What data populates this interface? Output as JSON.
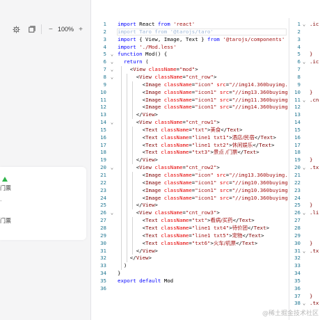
{
  "toolbar": {
    "settings_icon": "gear-icon",
    "layout_icon": "layout-icon",
    "zoom_out": "−",
    "zoom_level": "100%",
    "zoom_in": "+"
  },
  "preview_card": {
    "items": [
      "门票",
      "-",
      "门票"
    ]
  },
  "editor": {
    "lines": [
      {
        "n": "1",
        "fold": "",
        "segs": [
          [
            "kw",
            "import "
          ],
          [
            "",
            "React "
          ],
          [
            "kw",
            "from "
          ],
          [
            "str",
            "'react'"
          ]
        ]
      },
      {
        "n": "2",
        "fold": "",
        "segs": [
          [
            "faded",
            "import Taro from '@tarojs/taro'"
          ]
        ]
      },
      {
        "n": "3",
        "fold": "",
        "segs": [
          [
            "kw",
            "import "
          ],
          [
            "",
            "{ View, Image, Text } "
          ],
          [
            "kw",
            "from "
          ],
          [
            "str",
            "'@tarojs/components'"
          ]
        ]
      },
      {
        "n": "4",
        "fold": "",
        "segs": [
          [
            "kw",
            "import "
          ],
          [
            "str",
            "'./Mod.less'"
          ]
        ]
      },
      {
        "n": "5",
        "fold": "⌄",
        "segs": [
          [
            "kw",
            "function "
          ],
          [
            "",
            "Mod() {"
          ]
        ]
      },
      {
        "n": "6",
        "fold": "⌄",
        "segs": [
          [
            "",
            "  "
          ],
          [
            "kw",
            "return "
          ],
          [
            "",
            "("
          ]
        ]
      },
      {
        "n": "7",
        "fold": "⌄",
        "segs": [
          [
            "",
            "    <"
          ],
          [
            "tag",
            "View "
          ],
          [
            "attr",
            "className"
          ],
          [
            "",
            "="
          ],
          [
            "str",
            "\"mod\""
          ],
          [
            "",
            ">"
          ]
        ]
      },
      {
        "n": "8",
        "fold": "⌄",
        "segs": [
          [
            "",
            "      <"
          ],
          [
            "tag",
            "View "
          ],
          [
            "attr",
            "className"
          ],
          [
            "",
            "="
          ],
          [
            "str",
            "\"cnt_row\""
          ],
          [
            "",
            ">"
          ]
        ]
      },
      {
        "n": "9",
        "fold": "",
        "segs": [
          [
            "",
            "        <"
          ],
          [
            "tag",
            "Image "
          ],
          [
            "attr",
            "className"
          ],
          [
            "",
            "="
          ],
          [
            "str",
            "\"icon\" "
          ],
          [
            "attr",
            "src"
          ],
          [
            "",
            "="
          ],
          [
            "str",
            "\"//img14.360buyimg.co"
          ]
        ]
      },
      {
        "n": "10",
        "fold": "",
        "segs": [
          [
            "",
            "        <"
          ],
          [
            "tag",
            "Image "
          ],
          [
            "attr",
            "className"
          ],
          [
            "",
            "="
          ],
          [
            "str",
            "\"icon1\" "
          ],
          [
            "attr",
            "src"
          ],
          [
            "",
            "="
          ],
          [
            "str",
            "\"//img13.360buyimg.c"
          ]
        ]
      },
      {
        "n": "11",
        "fold": "",
        "segs": [
          [
            "",
            "        <"
          ],
          [
            "tag",
            "Image "
          ],
          [
            "attr",
            "className"
          ],
          [
            "",
            "="
          ],
          [
            "str",
            "\"icon1\" "
          ],
          [
            "attr",
            "src"
          ],
          [
            "",
            "="
          ],
          [
            "str",
            "\"//img11.360buyimg.c"
          ]
        ]
      },
      {
        "n": "12",
        "fold": "",
        "segs": [
          [
            "",
            "        <"
          ],
          [
            "tag",
            "Image "
          ],
          [
            "attr",
            "className"
          ],
          [
            "",
            "="
          ],
          [
            "str",
            "\"icon1\" "
          ],
          [
            "attr",
            "src"
          ],
          [
            "",
            "="
          ],
          [
            "str",
            "\"//img14.360buyimg.c"
          ]
        ]
      },
      {
        "n": "13",
        "fold": "",
        "segs": [
          [
            "",
            "      </"
          ],
          [
            "tag",
            "View"
          ],
          [
            "",
            ">"
          ]
        ]
      },
      {
        "n": "14",
        "fold": "⌄",
        "segs": [
          [
            "",
            "      <"
          ],
          [
            "tag",
            "View "
          ],
          [
            "attr",
            "className"
          ],
          [
            "",
            "="
          ],
          [
            "str",
            "\"cnt_row1\""
          ],
          [
            "",
            ">"
          ]
        ]
      },
      {
        "n": "15",
        "fold": "",
        "segs": [
          [
            "",
            "        <"
          ],
          [
            "tag",
            "Text "
          ],
          [
            "attr",
            "className"
          ],
          [
            "",
            "="
          ],
          [
            "str",
            "\"txt\""
          ],
          [
            "",
            ">"
          ],
          [
            "cjk",
            "美食"
          ],
          [
            "",
            "</"
          ],
          [
            "tag",
            "Text"
          ],
          [
            "",
            ">"
          ]
        ]
      },
      {
        "n": "16",
        "fold": "",
        "segs": [
          [
            "",
            "        <"
          ],
          [
            "tag",
            "Text "
          ],
          [
            "attr",
            "className"
          ],
          [
            "",
            "="
          ],
          [
            "str",
            "\"line1 txt1\""
          ],
          [
            "",
            ">"
          ],
          [
            "cjk",
            "酒店/民宿"
          ],
          [
            "",
            "</"
          ],
          [
            "tag",
            "Text"
          ],
          [
            "",
            ">"
          ]
        ]
      },
      {
        "n": "17",
        "fold": "",
        "segs": [
          [
            "",
            "        <"
          ],
          [
            "tag",
            "Text "
          ],
          [
            "attr",
            "className"
          ],
          [
            "",
            "="
          ],
          [
            "str",
            "\"line1 txt2\""
          ],
          [
            "",
            ">"
          ],
          [
            "cjk",
            "休闲娱乐"
          ],
          [
            "",
            "</"
          ],
          [
            "tag",
            "Text"
          ],
          [
            "",
            ">"
          ]
        ]
      },
      {
        "n": "18",
        "fold": "",
        "segs": [
          [
            "",
            "        <"
          ],
          [
            "tag",
            "Text "
          ],
          [
            "attr",
            "className"
          ],
          [
            "",
            "="
          ],
          [
            "str",
            "\"txt3\""
          ],
          [
            "",
            ">"
          ],
          [
            "cjk",
            "景点 /门票"
          ],
          [
            "",
            "</"
          ],
          [
            "tag",
            "Text"
          ],
          [
            "",
            ">"
          ]
        ]
      },
      {
        "n": "19",
        "fold": "",
        "segs": [
          [
            "",
            "      </"
          ],
          [
            "tag",
            "View"
          ],
          [
            "",
            ">"
          ]
        ]
      },
      {
        "n": "20",
        "fold": "⌄",
        "segs": [
          [
            "",
            "      <"
          ],
          [
            "tag",
            "View "
          ],
          [
            "attr",
            "className"
          ],
          [
            "",
            "="
          ],
          [
            "str",
            "\"cnt_row2\""
          ],
          [
            "",
            ">"
          ]
        ]
      },
      {
        "n": "21",
        "fold": "",
        "segs": [
          [
            "",
            "        <"
          ],
          [
            "tag",
            "Image "
          ],
          [
            "attr",
            "className"
          ],
          [
            "",
            "="
          ],
          [
            "str",
            "\"icon\" "
          ],
          [
            "attr",
            "src"
          ],
          [
            "",
            "="
          ],
          [
            "str",
            "\"//img13.360buyimg.co"
          ]
        ]
      },
      {
        "n": "22",
        "fold": "",
        "segs": [
          [
            "",
            "        <"
          ],
          [
            "tag",
            "Image "
          ],
          [
            "attr",
            "className"
          ],
          [
            "",
            "="
          ],
          [
            "str",
            "\"icon1\" "
          ],
          [
            "attr",
            "src"
          ],
          [
            "",
            "="
          ],
          [
            "str",
            "\"//img10.360buyimg.c"
          ]
        ]
      },
      {
        "n": "23",
        "fold": "",
        "segs": [
          [
            "",
            "        <"
          ],
          [
            "tag",
            "Image "
          ],
          [
            "attr",
            "className"
          ],
          [
            "",
            "="
          ],
          [
            "str",
            "\"icon1\" "
          ],
          [
            "attr",
            "src"
          ],
          [
            "",
            "="
          ],
          [
            "str",
            "\"//img10.360buyimg.c"
          ]
        ]
      },
      {
        "n": "24",
        "fold": "",
        "segs": [
          [
            "",
            "        <"
          ],
          [
            "tag",
            "Image "
          ],
          [
            "attr",
            "className"
          ],
          [
            "",
            "="
          ],
          [
            "str",
            "\"icon1\" "
          ],
          [
            "attr",
            "src"
          ],
          [
            "",
            "="
          ],
          [
            "str",
            "\"//img10.360buyimg.c"
          ]
        ]
      },
      {
        "n": "25",
        "fold": "",
        "segs": [
          [
            "",
            "      </"
          ],
          [
            "tag",
            "View"
          ],
          [
            "",
            ">"
          ]
        ]
      },
      {
        "n": "26",
        "fold": "⌄",
        "segs": [
          [
            "",
            "      <"
          ],
          [
            "tag",
            "View "
          ],
          [
            "attr",
            "className"
          ],
          [
            "",
            "="
          ],
          [
            "str",
            "\"cnt_row3\""
          ],
          [
            "",
            ">"
          ]
        ]
      },
      {
        "n": "27",
        "fold": "",
        "segs": [
          [
            "",
            "        <"
          ],
          [
            "tag",
            "Text "
          ],
          [
            "attr",
            "className"
          ],
          [
            "",
            "="
          ],
          [
            "str",
            "\"txt\""
          ],
          [
            "",
            ">"
          ],
          [
            "cjk",
            "看病/买药"
          ],
          [
            "",
            "</"
          ],
          [
            "tag",
            "Text"
          ],
          [
            "",
            ">"
          ]
        ]
      },
      {
        "n": "28",
        "fold": "",
        "segs": [
          [
            "",
            "        <"
          ],
          [
            "tag",
            "Text "
          ],
          [
            "attr",
            "className"
          ],
          [
            "",
            "="
          ],
          [
            "str",
            "\"line1 txt4\""
          ],
          [
            "",
            ">"
          ],
          [
            "cjk",
            "待价团"
          ],
          [
            "",
            "</"
          ],
          [
            "tag",
            "Text"
          ],
          [
            "",
            ">"
          ]
        ]
      },
      {
        "n": "29",
        "fold": "",
        "segs": [
          [
            "",
            "        <"
          ],
          [
            "tag",
            "Text "
          ],
          [
            "attr",
            "className"
          ],
          [
            "",
            "="
          ],
          [
            "str",
            "\"line1 txt5\""
          ],
          [
            "",
            ">"
          ],
          [
            "cjk",
            "宠物"
          ],
          [
            "",
            "</"
          ],
          [
            "tag",
            "Text"
          ],
          [
            "",
            ">"
          ]
        ]
      },
      {
        "n": "30",
        "fold": "",
        "segs": [
          [
            "",
            "        <"
          ],
          [
            "tag",
            "Text "
          ],
          [
            "attr",
            "className"
          ],
          [
            "",
            "="
          ],
          [
            "str",
            "\"txt6\""
          ],
          [
            "",
            ">"
          ],
          [
            "cjk",
            "火车/机票"
          ],
          [
            "",
            "</"
          ],
          [
            "tag",
            "Text"
          ],
          [
            "",
            ">"
          ]
        ]
      },
      {
        "n": "31",
        "fold": "",
        "segs": [
          [
            "",
            "      </"
          ],
          [
            "tag",
            "View"
          ],
          [
            "",
            ">"
          ]
        ]
      },
      {
        "n": "32",
        "fold": "",
        "segs": [
          [
            "",
            "    </"
          ],
          [
            "tag",
            "View"
          ],
          [
            "",
            ">"
          ]
        ]
      },
      {
        "n": "33",
        "fold": "",
        "segs": [
          [
            "",
            "  )"
          ]
        ]
      },
      {
        "n": "34",
        "fold": "",
        "segs": [
          [
            "",
            "}"
          ]
        ]
      },
      {
        "n": "35",
        "fold": "",
        "segs": [
          [
            "kw",
            "export default "
          ],
          [
            "",
            "Mod"
          ]
        ]
      },
      {
        "n": "36",
        "fold": "",
        "segs": []
      }
    ]
  },
  "right_pane": {
    "lines": [
      {
        "n": "1",
        "fold": "⌄",
        "code": ".ic"
      },
      {
        "n": "2",
        "fold": "",
        "code": ""
      },
      {
        "n": "3",
        "fold": "",
        "code": ""
      },
      {
        "n": "4",
        "fold": "",
        "code": ""
      },
      {
        "n": "5",
        "fold": "",
        "code": "}"
      },
      {
        "n": "6",
        "fold": "⌄",
        "code": ".ic"
      },
      {
        "n": "7",
        "fold": "",
        "code": ""
      },
      {
        "n": "8",
        "fold": "",
        "code": ""
      },
      {
        "n": "9",
        "fold": "",
        "code": ""
      },
      {
        "n": "10",
        "fold": "",
        "code": "}"
      },
      {
        "n": "11",
        "fold": "⌄",
        "code": ".cn"
      },
      {
        "n": "12",
        "fold": "",
        "code": ""
      },
      {
        "n": "13",
        "fold": "",
        "code": ""
      },
      {
        "n": "14",
        "fold": "",
        "code": ""
      },
      {
        "n": "15",
        "fold": "",
        "code": ""
      },
      {
        "n": "16",
        "fold": "",
        "code": ""
      },
      {
        "n": "17",
        "fold": "",
        "code": ""
      },
      {
        "n": "18",
        "fold": "",
        "code": ""
      },
      {
        "n": "19",
        "fold": "",
        "code": "}"
      },
      {
        "n": "20",
        "fold": "⌄",
        "code": ".tx"
      },
      {
        "n": "21",
        "fold": "",
        "code": ""
      },
      {
        "n": "22",
        "fold": "",
        "code": ""
      },
      {
        "n": "23",
        "fold": "",
        "code": ""
      },
      {
        "n": "24",
        "fold": "",
        "code": ""
      },
      {
        "n": "25",
        "fold": "",
        "code": "}"
      },
      {
        "n": "26",
        "fold": "⌄",
        "code": ".li"
      },
      {
        "n": "27",
        "fold": "",
        "code": ""
      },
      {
        "n": "28",
        "fold": "",
        "code": ""
      },
      {
        "n": "29",
        "fold": "",
        "code": ""
      },
      {
        "n": "30",
        "fold": "",
        "code": "}"
      },
      {
        "n": "31",
        "fold": "⌄",
        "code": ".tx"
      },
      {
        "n": "32",
        "fold": "",
        "code": ""
      },
      {
        "n": "33",
        "fold": "",
        "code": ""
      },
      {
        "n": "34",
        "fold": "",
        "code": ""
      },
      {
        "n": "35",
        "fold": "",
        "code": ""
      },
      {
        "n": "36",
        "fold": "",
        "code": ""
      },
      {
        "n": "37",
        "fold": "",
        "code": "}"
      },
      {
        "n": "38",
        "fold": "⌄",
        "code": ".tx"
      }
    ]
  },
  "watermark": "@稀土掘金技术社区"
}
